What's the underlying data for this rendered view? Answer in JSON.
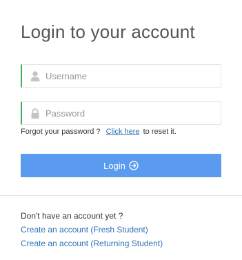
{
  "title": "Login to your account",
  "username": {
    "placeholder": "Username",
    "value": "",
    "icon": "user-icon"
  },
  "password": {
    "placeholder": "Password",
    "value": "",
    "icon": "lock-icon"
  },
  "forgot": {
    "prefix": "Forgot your password ?",
    "link": "Click here",
    "suffix": "to reset it."
  },
  "login_button": {
    "label": "Login",
    "icon": "circle-arrow-right-icon"
  },
  "signup": {
    "prompt": "Don't have an account yet ?",
    "fresh": "Create an account (Fresh Student)",
    "returning": "Create an account (Returning Student)"
  },
  "colors": {
    "accent_border": "#3cae5a",
    "button": "#5b9bef",
    "link": "#2f6fb6"
  }
}
